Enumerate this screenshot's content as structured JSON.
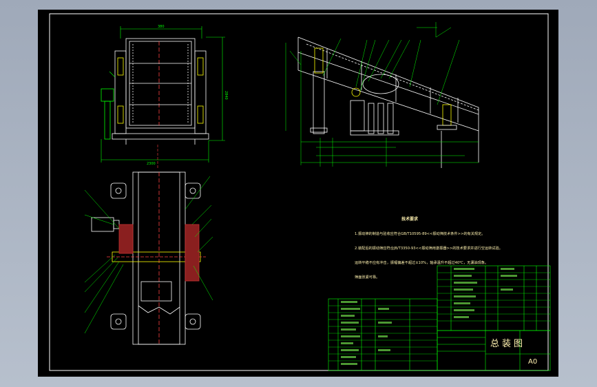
{
  "drawing": {
    "title_block": {
      "big_title": "总装图",
      "sheet_size": "A0"
    },
    "notes": {
      "heading": "技术要求",
      "lines": [
        "1.振动筛的制造与验收应符合GB/T10595-89<<振动筛技术条件>>的有关规定。",
        "2.装配后的振动筛应符合JB/T3350-93<<振动筛用激振器>>的技术要求并进行空运转试验。",
        "  运转平稳不应有冲击，振幅偏差不超过±10%，轴承温升不超过40℃，无漏油现象。",
        "  筛面张紧可靠。"
      ]
    },
    "dimensions": {
      "front_width": "380",
      "front_height": "2840",
      "front_base": "2300"
    }
  },
  "colors": {
    "frame_bg": "#000000",
    "line_white": "#ffffff",
    "line_green": "#00ff00",
    "line_yellow": "#ffff00",
    "line_cyan": "#00ffff",
    "line_red": "#ff2020",
    "hatch_red": "#c03030"
  }
}
